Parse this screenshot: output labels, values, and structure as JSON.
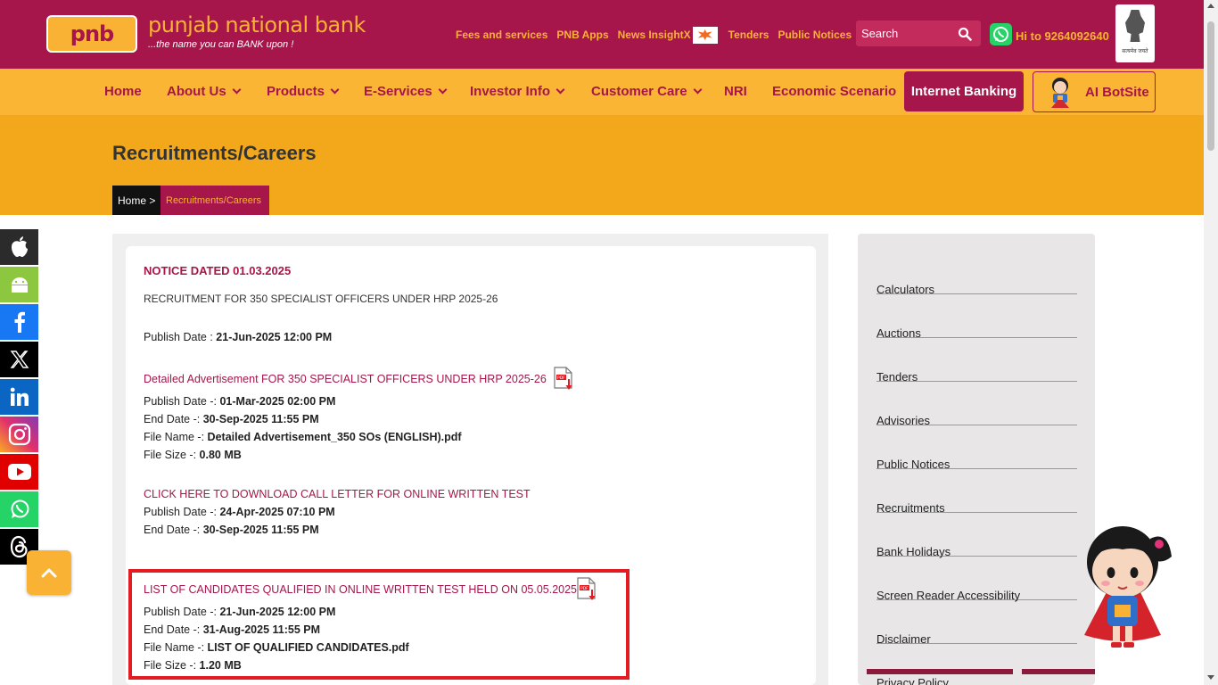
{
  "header": {
    "logo_mark": "pnb",
    "brand_name": "punjab national bank",
    "tagline": "...the name you can BANK upon !",
    "top_links": [
      "Fees and services",
      "PNB Apps",
      "News InsightX",
      "Tenders",
      "Public Notices"
    ],
    "search_placeholder": "Search",
    "whatsapp_text": "Hi to 9264092640",
    "emblem_caption": "सत्यमेव जयते"
  },
  "nav": {
    "items": [
      "Home",
      "About Us",
      "Products",
      "E-Services",
      "Investor Info",
      "Customer Care",
      "NRI",
      "Economic Scenario"
    ],
    "internet_banking": "Internet Banking",
    "ai_botsite": "AI BotSite"
  },
  "banner": {
    "title": "Recruitments/Careers",
    "breadcrumb_home": "Home >",
    "breadcrumb_current": "Recruitments/Careers"
  },
  "social": [
    "apple-icon",
    "android-icon",
    "facebook-icon",
    "x-icon",
    "linkedin-icon",
    "instagram-icon",
    "youtube-icon",
    "whatsapp-icon",
    "threads-icon"
  ],
  "colors": {
    "brand": "#a6164a",
    "accent": "#f9b233",
    "nav_bg": "#fbb534",
    "banner_bg": "#f2a81a",
    "highlight": "#e31b23"
  },
  "notice": {
    "title": "NOTICE DATED 01.03.2025",
    "subtitle": "RECRUITMENT FOR 350 SPECIALIST OFFICERS UNDER HRP 2025-26",
    "publish_label": "Publish Date : ",
    "publish_value": "21-Jun-2025 12:00 PM",
    "entries": [
      {
        "link": "Detailed Advertisement FOR 350 SPECIALIST OFFICERS UNDER HRP 2025-26",
        "publish_label": "Publish Date -: ",
        "publish": "01-Mar-2025 02:00 PM",
        "end_label": "End Date -: ",
        "end": "30-Sep-2025 11:55 PM",
        "file_label": "File Name -: ",
        "file": "Detailed Advertisement_350 SOs (ENGLISH).pdf",
        "size_label": "File Size -: ",
        "size": "0.80 MB"
      },
      {
        "link": "CLICK HERE TO DOWNLOAD CALL LETTER FOR ONLINE WRITTEN TEST",
        "publish_label": "Publish Date -: ",
        "publish": "24-Apr-2025 07:10 PM",
        "end_label": "End Date -: ",
        "end": "30-Sep-2025 11:55 PM"
      },
      {
        "link": "LIST OF CANDIDATES QUALIFIED IN ONLINE WRITTEN TEST HELD ON 05.05.2025",
        "publish_label": "Publish Date -: ",
        "publish": "21-Jun-2025 12:00 PM",
        "end_label": "End Date -: ",
        "end": "31-Aug-2025 11:55 PM",
        "file_label": "File Name -: ",
        "file": "LIST OF QUALIFIED CANDIDATES.pdf",
        "size_label": "File Size -: ",
        "size": "1.20 MB"
      }
    ]
  },
  "sidebar": {
    "items": [
      "Calculators",
      "Auctions",
      "Tenders",
      "Advisories",
      "Public Notices",
      "Recruitments",
      "Bank Holidays",
      "Screen Reader Accessibility",
      "Disclaimer",
      "Privacy Policy"
    ]
  }
}
